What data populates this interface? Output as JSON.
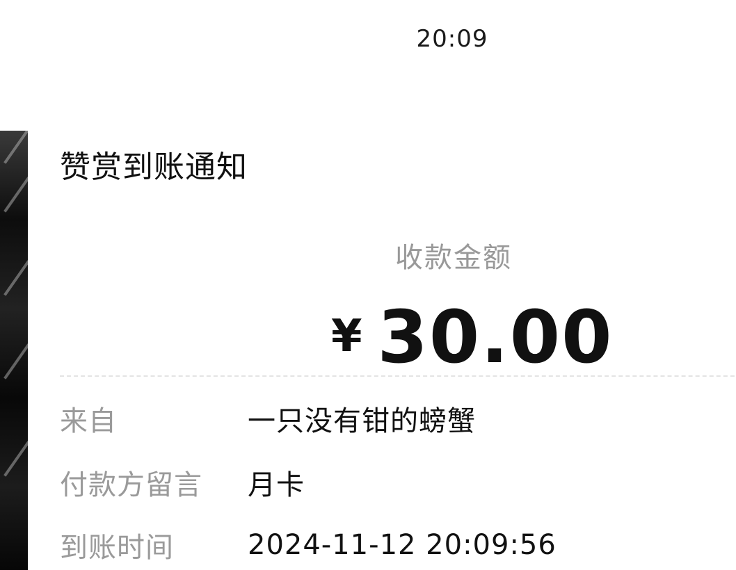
{
  "status_bar": {
    "time": "20:09"
  },
  "notification": {
    "title": "赞赏到账通知",
    "amount_label": "收款金额",
    "currency_symbol": "¥",
    "amount": "30.00",
    "details": [
      {
        "key": "来自",
        "value": "一只没有钳的螃蟹"
      },
      {
        "key": "付款方留言",
        "value": "月卡"
      },
      {
        "key": "到账时间",
        "value": "2024-11-12 20:09:56"
      }
    ]
  },
  "colors": {
    "primary_text": "#111111",
    "secondary_text": "#999999",
    "background": "#ffffff",
    "divider": "#e4e4e4"
  }
}
